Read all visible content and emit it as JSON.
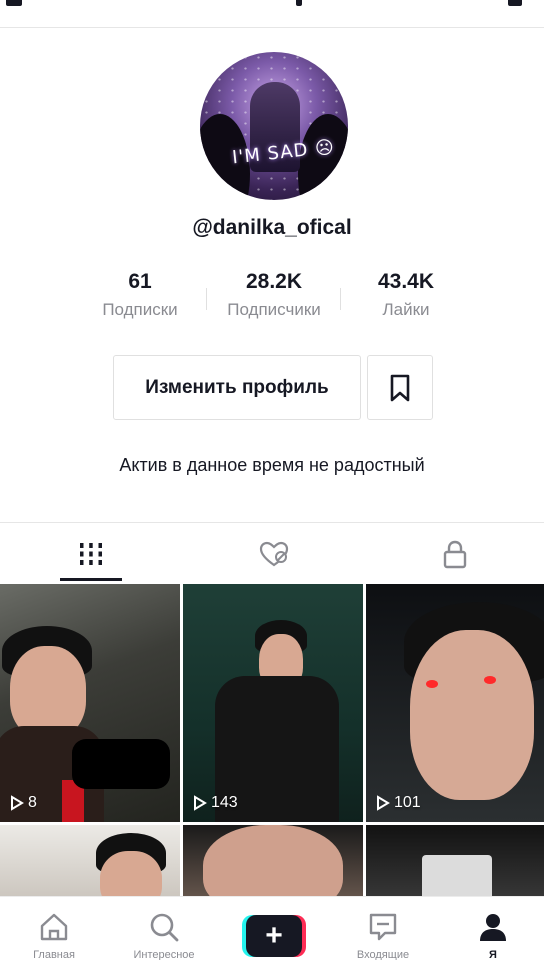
{
  "profile": {
    "username": "@danilka_ofical",
    "avatar_text": "I'M SAD ☹",
    "bio": "Актив в данное время не радостный"
  },
  "stats": [
    {
      "value": "61",
      "label": "Подписки"
    },
    {
      "value": "28.2K",
      "label": "Подписчики"
    },
    {
      "value": "43.4K",
      "label": "Лайки"
    }
  ],
  "actions": {
    "edit_profile": "Изменить профиль",
    "bookmark_icon": "bookmark-icon"
  },
  "tabs": [
    {
      "icon": "grid-icon",
      "active": true
    },
    {
      "icon": "liked-heart-icon",
      "active": false
    },
    {
      "icon": "lock-icon",
      "active": false
    }
  ],
  "videos": [
    {
      "views": "8"
    },
    {
      "views": "143"
    },
    {
      "views": "101"
    },
    {
      "views": ""
    },
    {
      "views": ""
    },
    {
      "views": ""
    }
  ],
  "nav": {
    "home": "Главная",
    "discover": "Интересное",
    "create": "+",
    "inbox": "Входящие",
    "me": "Я"
  },
  "colors": {
    "text": "#161823",
    "secondary": "#8a8b91",
    "cyan": "#25f4ee",
    "red": "#fe2c55"
  }
}
